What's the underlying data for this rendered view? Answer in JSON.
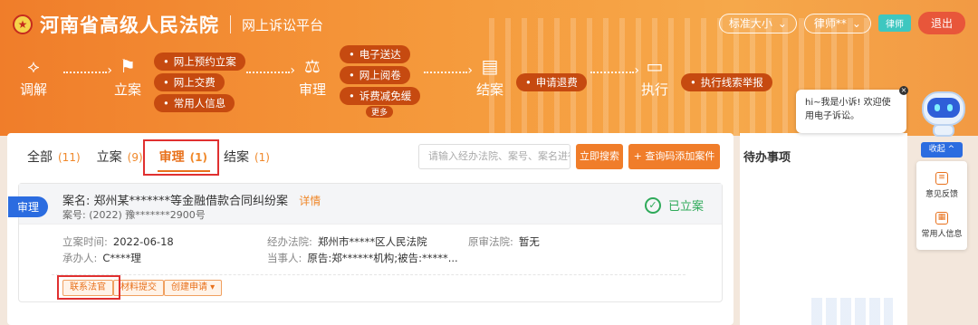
{
  "header": {
    "court_name": "河南省高级人民法院",
    "platform": "网上诉讼平台",
    "font_size_label": "标准大小",
    "user_name": "律师**",
    "role_badge": "律师",
    "logout": "退出"
  },
  "flow": {
    "stages": [
      {
        "label": "调解",
        "icon": "handshake-icon"
      },
      {
        "label": "立案",
        "icon": "flag-icon"
      },
      {
        "label": "审理",
        "icon": "gavel-icon"
      },
      {
        "label": "结案",
        "icon": "clipboard-icon"
      },
      {
        "label": "执行",
        "icon": "monitor-icon"
      }
    ],
    "filing_actions": [
      "网上预约立案",
      "网上交费",
      "常用人信息"
    ],
    "trial_actions": [
      "电子送达",
      "网上阅卷",
      "诉费减免缓"
    ],
    "trial_more": "更多",
    "closing_action": "申请退费",
    "execution_action": "执行线索举报"
  },
  "tabs": [
    {
      "label": "全部",
      "count": "(11)"
    },
    {
      "label": "立案",
      "count": "(9)"
    },
    {
      "label": "审理",
      "count": "(1)"
    },
    {
      "label": "结案",
      "count": "(1)"
    }
  ],
  "search": {
    "placeholder": "请输入经办法院、案号、案名进行",
    "search_button": "立即搜索",
    "add_button": "+ 查询码添加案件"
  },
  "case": {
    "stage_tag": "审理",
    "name_label": "案名:",
    "name": "郑州某*******等金融借款合同纠纷案",
    "detail_link": "详情",
    "number_label": "案号:",
    "number": "(2022) 豫*******2900号",
    "status": "已立案",
    "filing_time_label": "立案时间:",
    "filing_time": "2022-06-18",
    "court_label": "经办法院:",
    "court": "郑州市*****区人民法院",
    "original_court_label": "原审法院:",
    "original_court": "暂无",
    "handler_label": "承办人:",
    "handler": "C****理",
    "parties_label": "当事人:",
    "parties": "原告:郑******机构;被告:*****...",
    "actions": [
      "联系法官",
      "材料提交",
      "创建申请 ▾"
    ]
  },
  "todo": {
    "title": "待办事项"
  },
  "assistant": {
    "greeting": "hi~我是小诉! 欢迎使用电子诉讼。",
    "collapse": "收起 ^",
    "tools": [
      "意见反馈",
      "常用人信息"
    ]
  },
  "colors": {
    "accent": "#f07d2a",
    "primary_blue": "#2b6ce0",
    "success": "#2faa5a",
    "highlight_box": "#e03030"
  }
}
